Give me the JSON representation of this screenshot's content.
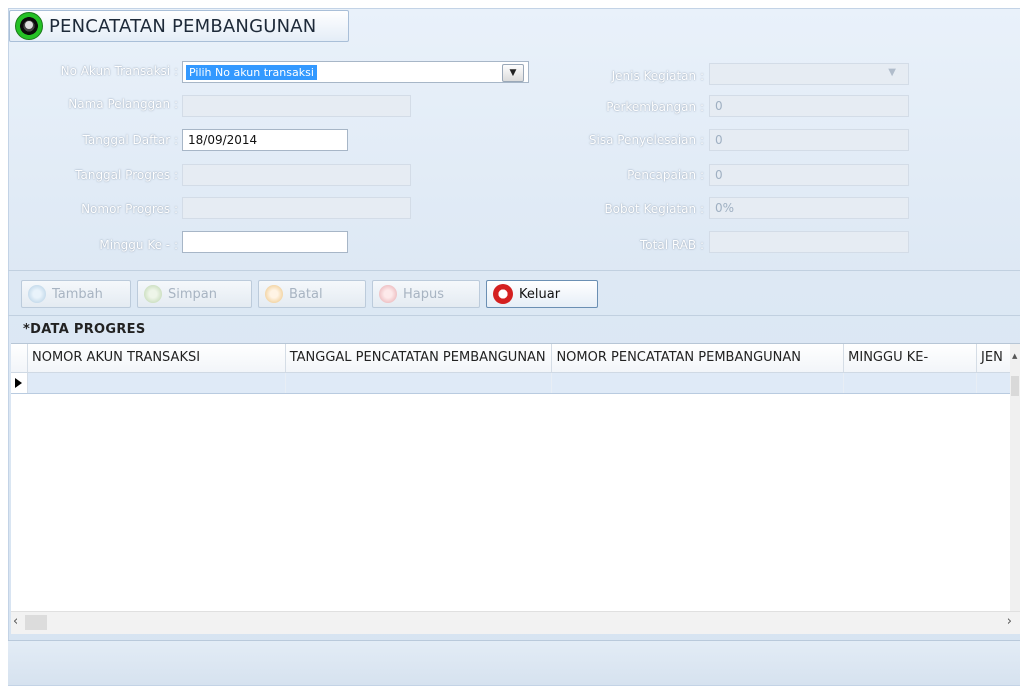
{
  "window": {
    "title": "PENCATATAN PEMBANGUNAN"
  },
  "form": {
    "no_akun_label": "No Akun Transaksi :",
    "no_akun_value": "Pilih No akun transaksi",
    "nama_label": "Nama Pelanggan :",
    "nama_value": "",
    "tgl_daftar_label": "Tanggal Daftar :",
    "tgl_daftar_value": "18/09/2014",
    "tgl_progres_label": "Tanggal Progres :",
    "tgl_progres_value": "",
    "nomor_progres_label": "Nomor Progres :",
    "nomor_progres_value": "",
    "minggu_label": "Minggu Ke - :",
    "minggu_value": "",
    "jenis_label": "Jenis Kegiatan :",
    "jenis_value": "",
    "perkembangan_label": "Perkembangan :",
    "perkembangan_value": "0",
    "sisa_label": "Sisa Penyelesaian :",
    "sisa_value": "0",
    "pencapaian_label": "Pencapaian :",
    "pencapaian_value": "0",
    "bobot_label": "Bobot Kegiatan :",
    "bobot_value": "0%",
    "total_rab_label": "Total RAB :",
    "total_rab_value": ""
  },
  "toolbar": {
    "tambah": "Tambah",
    "simpan": "Simpan",
    "batal": "Batal",
    "hapus": "Hapus",
    "keluar": "Keluar"
  },
  "grid": {
    "title": "*DATA PROGRES",
    "columns": [
      "NOMOR AKUN TRANSAKSI",
      "TANGGAL PENCATATAN PEMBANGUNAN",
      "NOMOR PENCATATAN PEMBANGUNAN",
      "MINGGU KE-",
      "JEN"
    ]
  },
  "colors": {
    "accent": "#3399ff",
    "keluar_icon": "#d42020"
  },
  "icons": [
    "window-icon",
    "dropdown-arrow-icon",
    "tambah-icon",
    "simpan-icon",
    "batal-icon",
    "hapus-icon",
    "keluar-icon",
    "row-pointer-icon"
  ]
}
